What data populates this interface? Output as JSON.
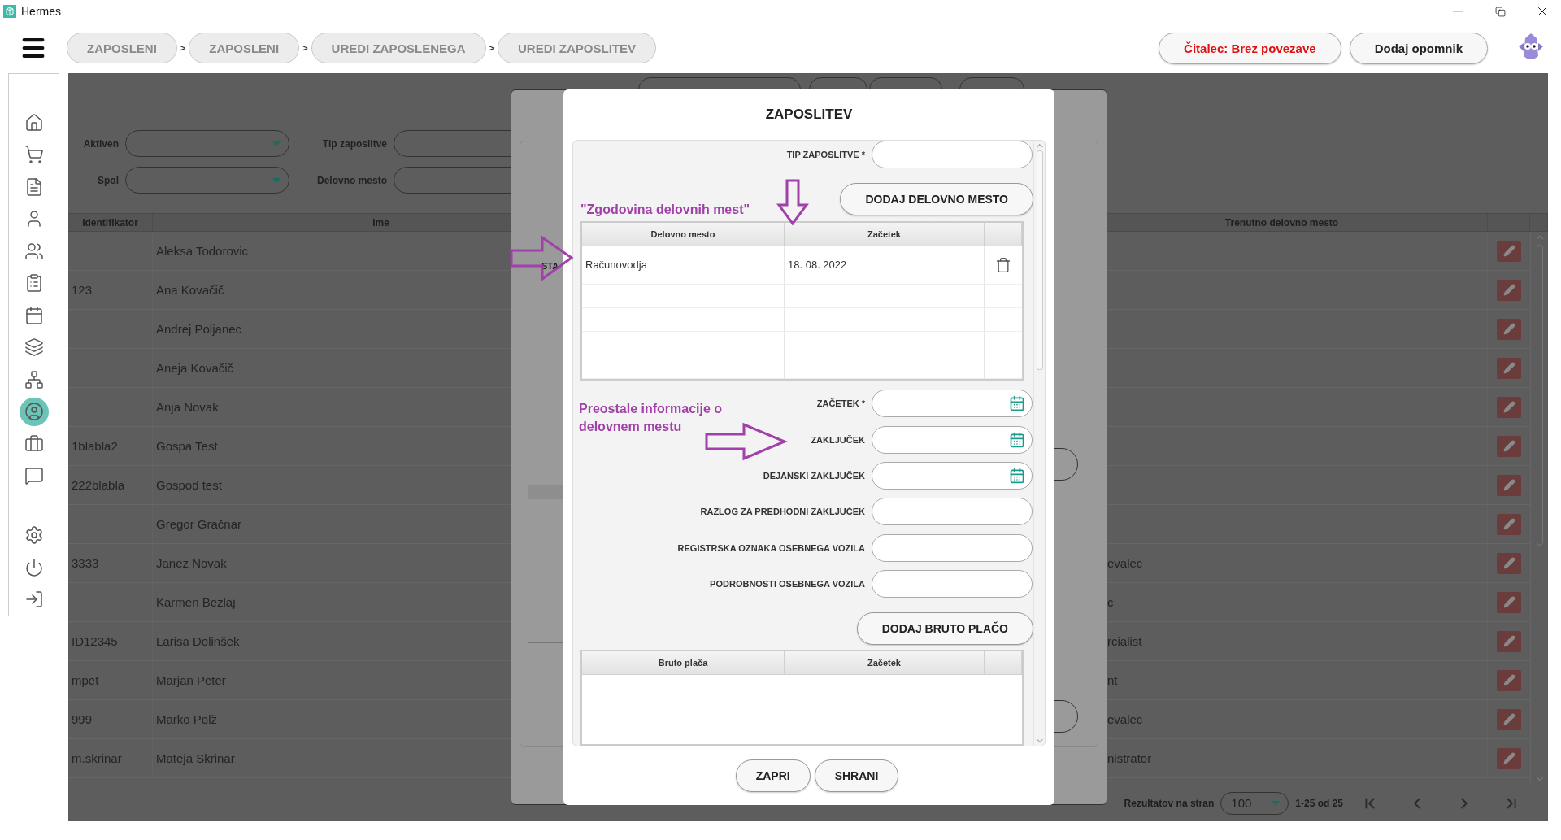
{
  "window": {
    "title": "Hermes"
  },
  "breadcrumbs": [
    {
      "label": "ZAPOSLENI",
      "separator": ">"
    },
    {
      "label": "ZAPOSLENI",
      "separator": ">"
    },
    {
      "label": "UREDI ZAPOSLENEGA",
      "separator": ">"
    },
    {
      "label": "UREDI ZAPOSLITEV"
    }
  ],
  "header_buttons": [
    {
      "label": "Čitalec: Brez povezave",
      "kind": "alert"
    },
    {
      "label": "Dodaj opomnik",
      "kind": "normal"
    }
  ],
  "sidebar": {
    "items": [
      {
        "selected": false
      },
      {
        "selected": false
      },
      {
        "selected": false
      },
      {
        "selected": false
      },
      {
        "selected": false
      },
      {
        "selected": false
      },
      {
        "selected": false
      },
      {
        "selected": false
      },
      {
        "selected": false
      },
      {
        "selected": true
      },
      {
        "selected": false
      },
      {
        "selected": false
      }
    ],
    "bottom_items": [
      {
        "selected": false
      },
      {
        "selected": false
      },
      {
        "selected": false
      }
    ]
  },
  "filters": [
    {
      "label": "Aktiven",
      "kind": "dropdown"
    },
    {
      "label": "Tip zaposlitve",
      "kind": "text"
    },
    {
      "label": "Spol",
      "kind": "dropdown"
    },
    {
      "label": "Delovno mesto",
      "kind": "search"
    }
  ],
  "table": {
    "columns": [
      "Identifikator",
      "Ime",
      "Trenutno delovno mesto"
    ],
    "rows": [
      {
        "id": "",
        "name": "Aleksa Todorovic",
        "position": ""
      },
      {
        "id": "123",
        "name": "Ana Kovačič",
        "position": ""
      },
      {
        "id": "",
        "name": "Andrej Poljanec",
        "position": ""
      },
      {
        "id": "",
        "name": "Aneja  Kovačič",
        "position": ""
      },
      {
        "id": "",
        "name": "Anja Novak",
        "position": ""
      },
      {
        "id": "1blabla2",
        "name": "Gospa Test",
        "position": ""
      },
      {
        "id": "222blabla",
        "name": "Gospod test",
        "position": ""
      },
      {
        "id": "",
        "name": "Gregor Gračnar",
        "position": ""
      },
      {
        "id": "3333",
        "name": "Janez Novak",
        "position": "evalec"
      },
      {
        "id": "",
        "name": "Karmen Bezlaj",
        "position": "c"
      },
      {
        "id": "ID12345",
        "name": "Larisa Dolinšek",
        "position": "rcialist"
      },
      {
        "id": "mpet",
        "name": "Marjan Peter",
        "position": "nt"
      },
      {
        "id": "999",
        "name": "Marko Polž",
        "position": "evalec"
      },
      {
        "id": "m.skrinar",
        "name": "Mateja Skrinar",
        "position": "nistrator"
      }
    ]
  },
  "pagination": {
    "label": "Rezultatov na stran",
    "page_size": "100",
    "range": "1-25 od 25"
  },
  "back_dialog": {
    "labels": [
      "STA"
    ]
  },
  "dialog": {
    "title": "ZAPOSLITEV",
    "type_field": {
      "label": "TIP ZAPOSLITVE *"
    },
    "add_position_button": "DODAJ DELOVNO MESTO",
    "positions_table": {
      "columns": [
        "Delovno mesto",
        "Začetek"
      ],
      "rows": [
        {
          "position": "Računovodja",
          "start": "18. 08. 2022"
        }
      ]
    },
    "detail_fields": [
      {
        "label": "ZAČETEK *",
        "kind": "date"
      },
      {
        "label": "ZAKLJUČEK",
        "kind": "date"
      },
      {
        "label": "DEJANSKI ZAKLJUČEK",
        "kind": "date"
      },
      {
        "label": "RAZLOG ZA PREDHODNI ZAKLJUČEK",
        "kind": "text"
      },
      {
        "label": "REGISTRSKA OZNAKA OSEBNEGA VOZILA",
        "kind": "text"
      },
      {
        "label": "PODROBNOSTI OSEBNEGA VOZILA",
        "kind": "text"
      }
    ],
    "add_salary_button": "DODAJ BRUTO PLAČO",
    "salary_table": {
      "columns": [
        "Bruto plača",
        "Začetek"
      ]
    },
    "buttons": [
      "ZAPRI",
      "SHRANI"
    ]
  },
  "annotations": [
    {
      "text": "\"Zgodovina delovnih mest\""
    },
    {
      "text": "Preostale informacije o delovnem mestu"
    }
  ]
}
